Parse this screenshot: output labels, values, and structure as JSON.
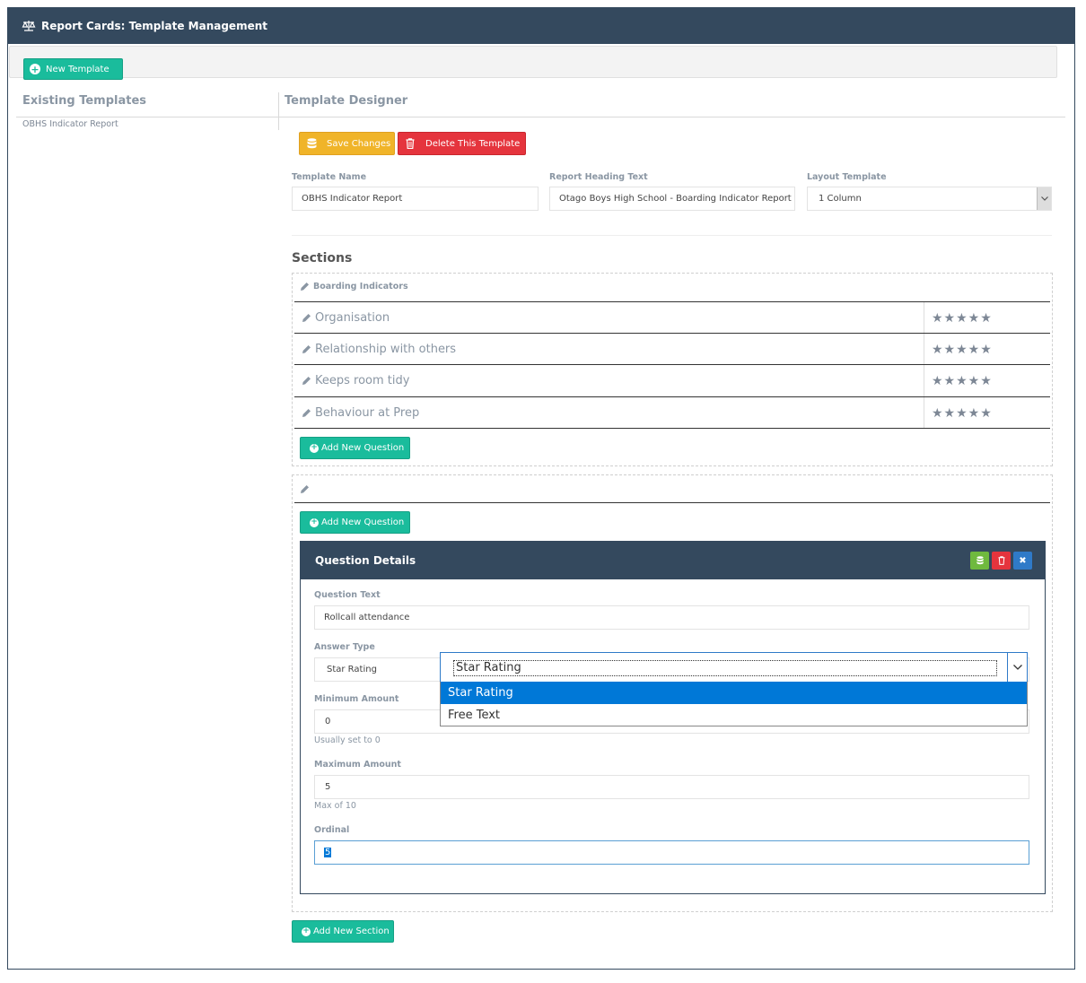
{
  "window": {
    "title": "Report Cards: Template Management"
  },
  "toolbar": {
    "new_template": "New Template"
  },
  "sidebar": {
    "heading": "Existing Templates",
    "templates": [
      "OBHS Indicator Report"
    ]
  },
  "designer": {
    "heading": "Template Designer",
    "save_label": "Save Changes",
    "delete_label": "Delete This Template",
    "template_name_label": "Template Name",
    "template_name_value": "OBHS Indicator Report",
    "report_heading_label": "Report Heading Text",
    "report_heading_value": "Otago Boys High School - Boarding Indicator Report",
    "layout_label": "Layout Template",
    "layout_value": "1 Column",
    "sections_heading": "Sections",
    "add_section": "Add New Section"
  },
  "sections": [
    {
      "title": "Boarding Indicators",
      "questions": [
        {
          "text": "Organisation",
          "answer": "★★★★★"
        },
        {
          "text": "Relationship with others",
          "answer": "★★★★★"
        },
        {
          "text": "Keeps room tidy",
          "answer": "★★★★★"
        },
        {
          "text": "Behaviour at Prep",
          "answer": "★★★★★"
        }
      ],
      "add_question": "Add New Question"
    },
    {
      "title": "",
      "add_question": "Add New Question"
    }
  ],
  "question_details": {
    "title": "Question Details",
    "question_text_label": "Question Text",
    "question_text_value": "Rollcall attendance",
    "answer_type_label": "Answer Type",
    "answer_type_value": "Star Rating",
    "answer_type_options": [
      "Star Rating",
      "Free Text"
    ],
    "min_label": "Minimum Amount",
    "min_value": "0",
    "min_hint": "Usually set to 0",
    "max_label": "Maximum Amount",
    "max_value": "5",
    "max_hint": "Max of 10",
    "ordinal_label": "Ordinal",
    "ordinal_value": "5"
  },
  "colors": {
    "header": "#34495e",
    "teal": "#1abc9c",
    "yellow": "#f0b429",
    "red": "#e5343d",
    "green": "#6fb93e",
    "blue": "#2f7ac8"
  }
}
